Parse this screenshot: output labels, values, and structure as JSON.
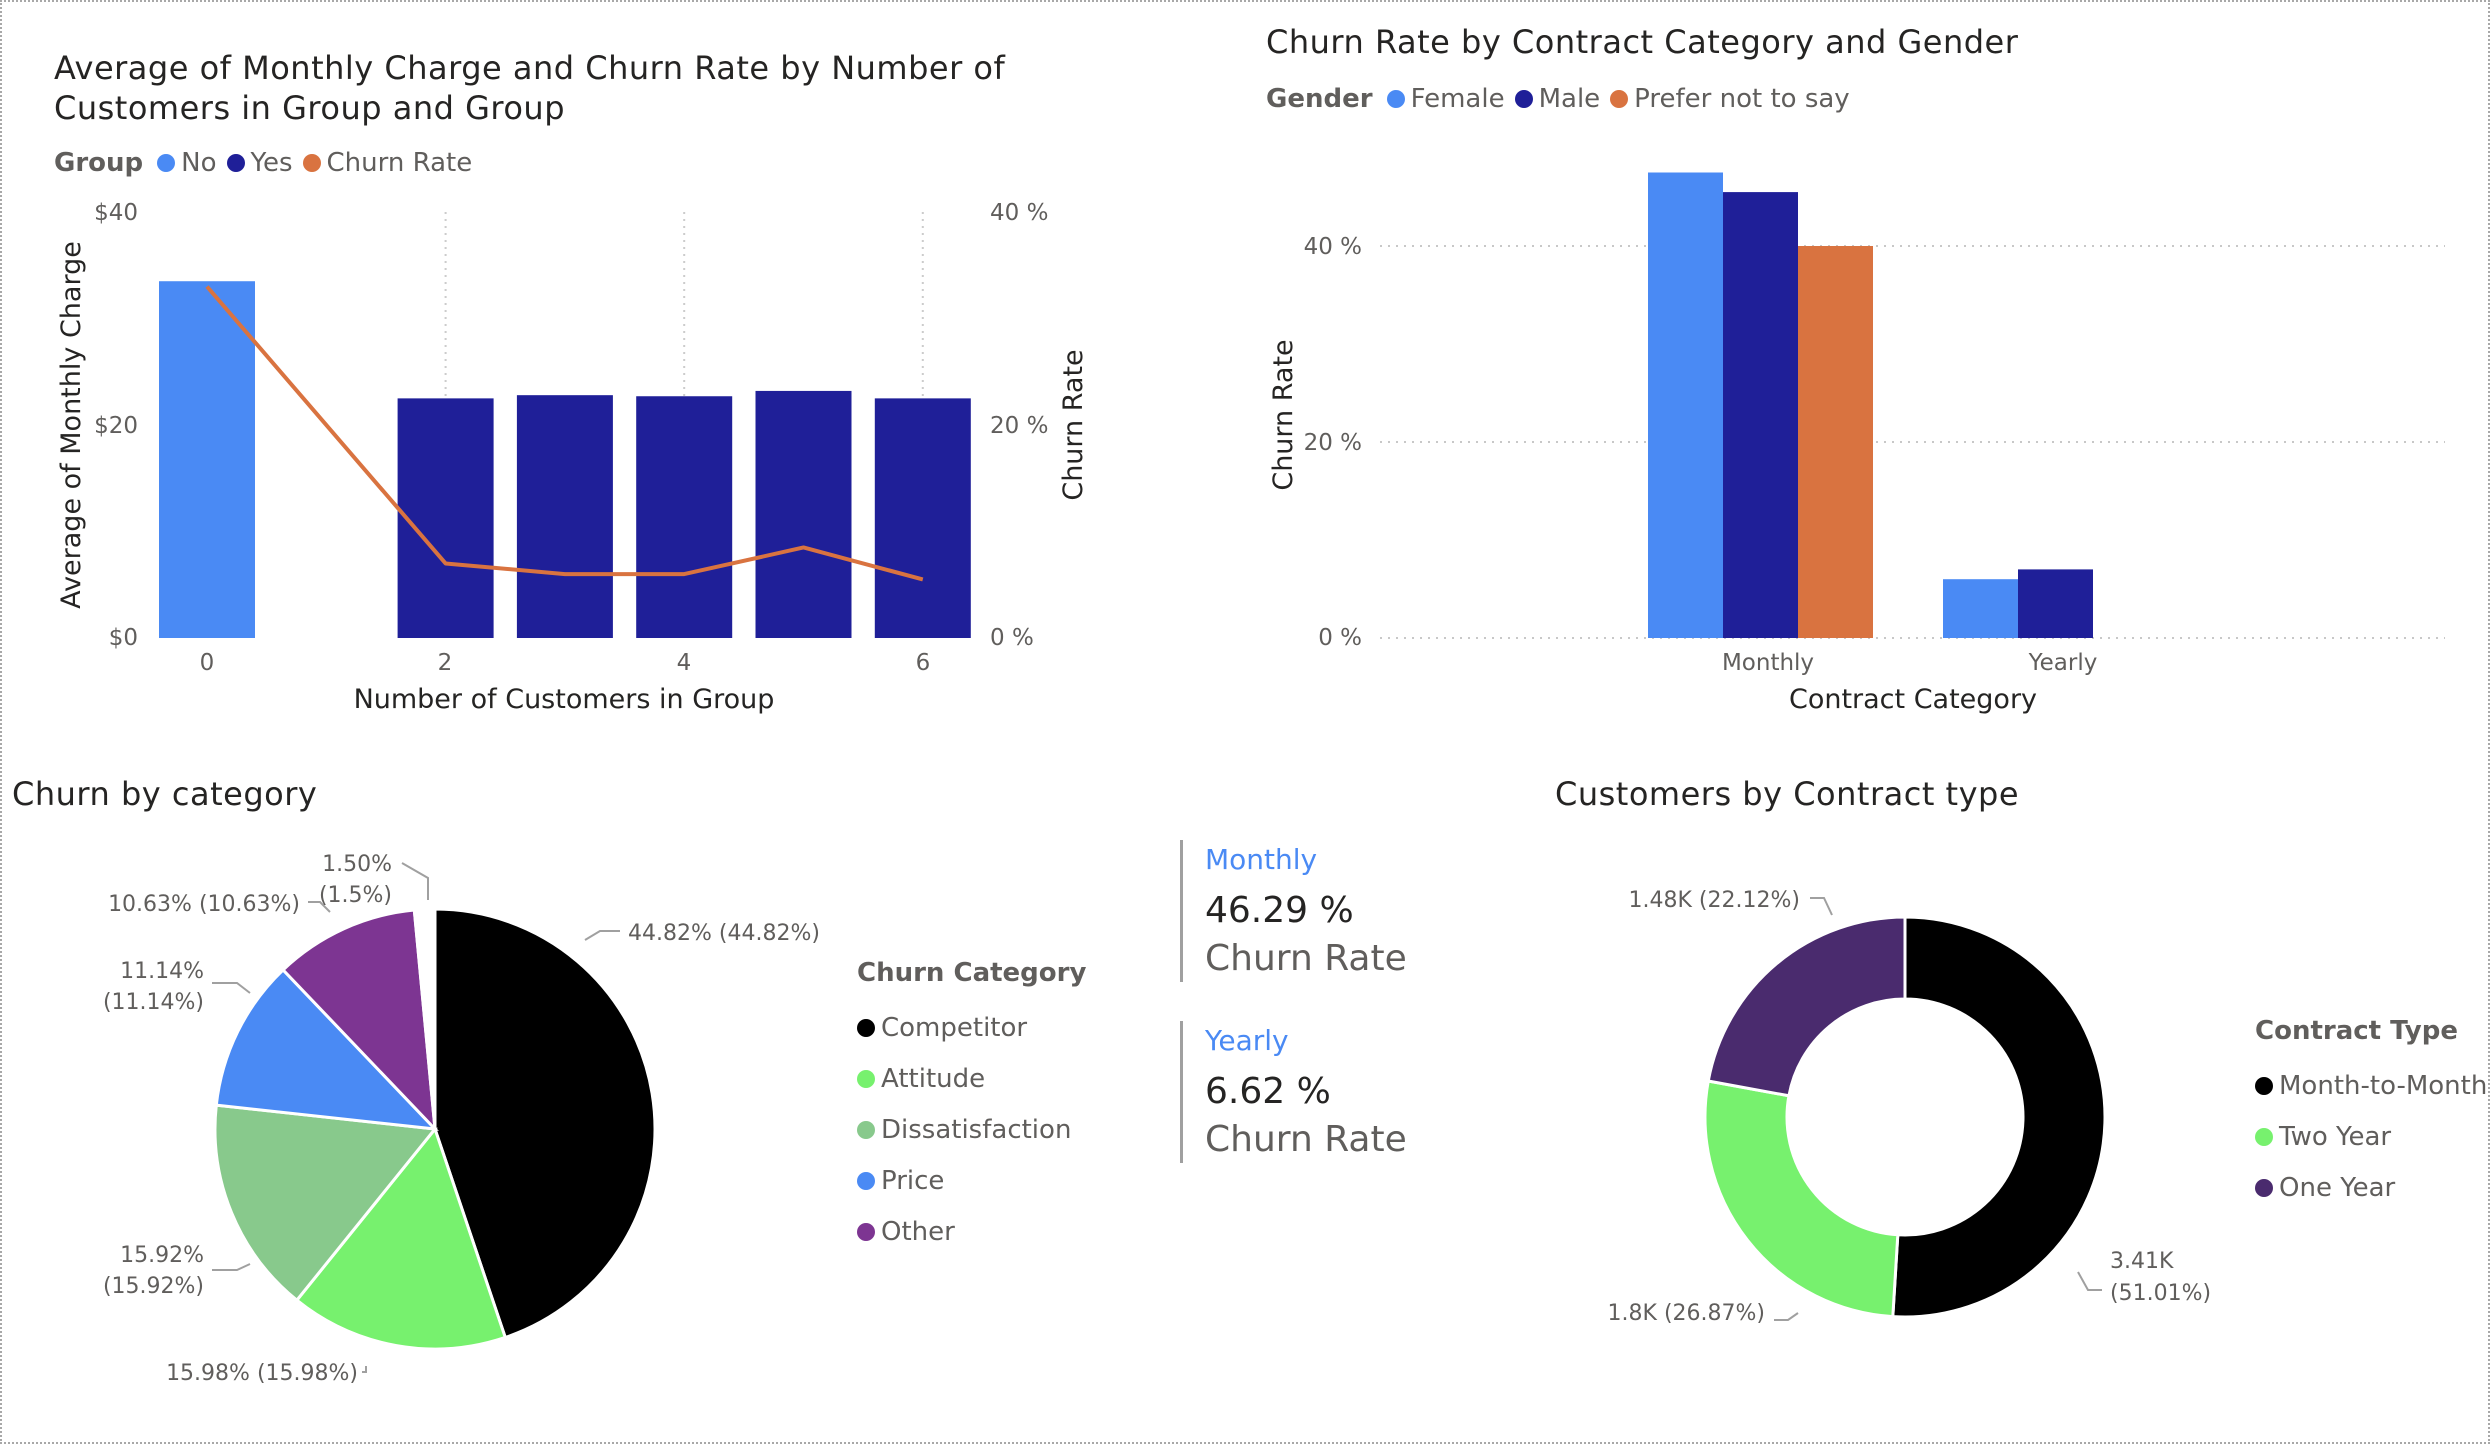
{
  "colors": {
    "light_blue": "#4a8af4",
    "dark_blue": "#1f1f98",
    "orange": "#d97340",
    "black": "#000000",
    "green": "#77f16e",
    "sage": "#88c98c",
    "purple": "#7d3592",
    "dark_purple": "#4a2b6e"
  },
  "chart1": {
    "title": "Average of Monthly Charge and Churn Rate by Number of Customers in Group and Group",
    "legend_title": "Group",
    "legend": [
      "No",
      "Yes",
      "Churn Rate"
    ],
    "xlabel": "Number of Customers in Group",
    "ylabel": "Average of Monthly Charge",
    "y2label": "Churn Rate",
    "yticks": [
      "$0",
      "$20",
      "$40"
    ],
    "y2ticks": [
      "0 %",
      "20 %",
      "40 %"
    ],
    "xticks": [
      "0",
      "2",
      "4",
      "6"
    ]
  },
  "chart2": {
    "title": "Churn Rate by Contract Category and Gender",
    "legend_title": "Gender",
    "legend": [
      "Female",
      "Male",
      "Prefer not to say"
    ],
    "xlabel": "Contract Category",
    "ylabel": "Churn Rate",
    "yticks": [
      "0 %",
      "20 %",
      "40 %"
    ]
  },
  "chart3": {
    "title": "Churn by category",
    "legend_title": "Churn Category",
    "legend": [
      "Competitor",
      "Attitude",
      "Dissatisfaction",
      "Price",
      "Other"
    ]
  },
  "chart4": {
    "title": "Customers by Contract type",
    "legend_title": "Contract Type",
    "legend": [
      "Month-to-Month",
      "Two Year",
      "One Year"
    ]
  },
  "cards": [
    {
      "title": "Monthly",
      "value": "46.29 %",
      "label": "Churn Rate"
    },
    {
      "title": "Yearly",
      "value": "6.62 %",
      "label": "Churn Rate"
    }
  ],
  "chart_data": [
    {
      "type": "bar",
      "title": "Average of Monthly Charge and Churn Rate by Number of Customers in Group and Group",
      "xlabel": "Number of Customers in Group",
      "ylabel": "Average of Monthly Charge",
      "y2label": "Churn Rate",
      "ylim": [
        0,
        40
      ],
      "y2lim": [
        0,
        40
      ],
      "x": [
        0,
        2,
        3,
        4,
        5,
        6
      ],
      "series": [
        {
          "name": "No",
          "type": "bar",
          "x": [
            0
          ],
          "values": [
            33.5
          ]
        },
        {
          "name": "Yes",
          "type": "bar",
          "x": [
            2,
            3,
            4,
            5,
            6
          ],
          "values": [
            22.5,
            22.8,
            22.7,
            23.2,
            22.5
          ]
        },
        {
          "name": "Churn Rate",
          "type": "line",
          "axis": "secondary",
          "x": [
            0,
            2,
            3,
            4,
            5,
            6
          ],
          "values": [
            33,
            7,
            6,
            6,
            8.5,
            5.5
          ]
        }
      ],
      "legend_position": "top-left"
    },
    {
      "type": "bar",
      "title": "Churn Rate by Contract Category and Gender",
      "xlabel": "Contract Category",
      "ylabel": "Churn Rate",
      "ylim": [
        0,
        46
      ],
      "categories": [
        "Monthly",
        "Yearly"
      ],
      "series": [
        {
          "name": "Female",
          "values": [
            47.5,
            6
          ]
        },
        {
          "name": "Male",
          "values": [
            45.5,
            7
          ]
        },
        {
          "name": "Prefer not to say",
          "values": [
            40,
            null
          ]
        }
      ],
      "legend_position": "top-left"
    },
    {
      "type": "pie",
      "title": "Churn by category",
      "categories": [
        "Competitor",
        "Attitude",
        "Dissatisfaction",
        "Price",
        "Other",
        "Unlabeled"
      ],
      "values": [
        44.82,
        15.98,
        15.92,
        11.14,
        10.63,
        1.5
      ],
      "labels": [
        "44.82% (44.82%)",
        "15.98% (15.98%)",
        "15.92% (15.92%)",
        "11.14% (11.14%)",
        "10.63% (10.63%)",
        "1.50% (1.5%)"
      ],
      "legend_position": "right"
    },
    {
      "type": "pie",
      "subtype": "donut",
      "title": "Customers by Contract type",
      "categories": [
        "Month-to-Month",
        "Two Year",
        "One Year"
      ],
      "values": [
        3410,
        1800,
        1480
      ],
      "percentages": [
        51.01,
        26.87,
        22.12
      ],
      "labels": [
        "3.41K (51.01%)",
        "1.8K (26.87%)",
        "1.48K (22.12%)"
      ],
      "legend_position": "right"
    }
  ]
}
